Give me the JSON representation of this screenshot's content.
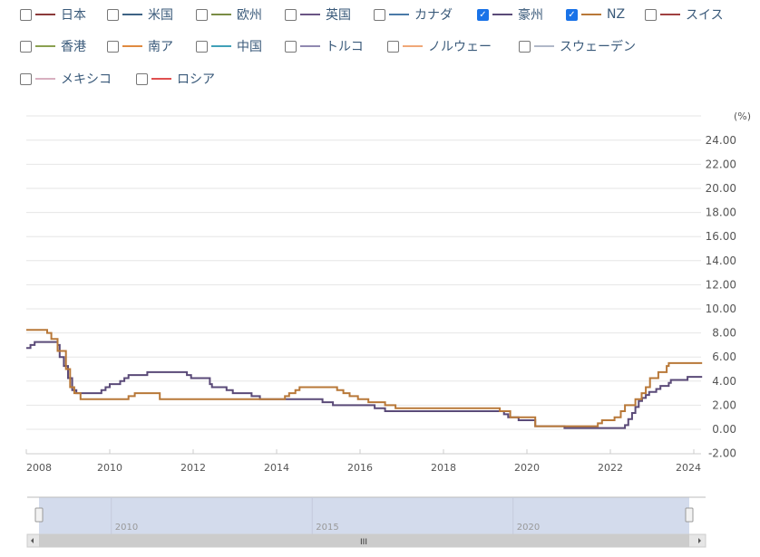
{
  "legend": [
    {
      "label": "日本",
      "color": "#8b3a3a",
      "checked": false
    },
    {
      "label": "米国",
      "color": "#3e6384",
      "checked": false
    },
    {
      "label": "欧州",
      "color": "#7a8c45",
      "checked": false
    },
    {
      "label": "英国",
      "color": "#6a5584",
      "checked": false
    },
    {
      "label": "カナダ",
      "color": "#4a7aa8",
      "checked": false
    },
    {
      "label": "豪州",
      "color": "#5a4a78",
      "checked": true
    },
    {
      "label": "NZ",
      "color": "#b87838",
      "checked": true
    },
    {
      "label": "スイス",
      "color": "#a04040",
      "checked": false
    },
    {
      "label": "香港",
      "color": "#8aa050",
      "checked": false
    },
    {
      "label": "南ア",
      "color": "#e08a40",
      "checked": false
    },
    {
      "label": "中国",
      "color": "#40a0b8",
      "checked": false
    },
    {
      "label": "トルコ",
      "color": "#9088b0",
      "checked": false
    },
    {
      "label": "ノルウェー",
      "color": "#f0a878",
      "checked": false
    },
    {
      "label": "スウェーデン",
      "color": "#b0b8c8",
      "checked": false
    },
    {
      "label": "メキシコ",
      "color": "#d8b0c0",
      "checked": false
    },
    {
      "label": "ロシア",
      "color": "#e05050",
      "checked": false
    }
  ],
  "chart_data": {
    "type": "line",
    "step": true,
    "ylabel": "(%)",
    "ylim": [
      -2,
      26
    ],
    "yticks": [
      "24.00",
      "22.00",
      "20.00",
      "18.00",
      "16.00",
      "14.00",
      "12.00",
      "10.00",
      "8.00",
      "6.00",
      "4.00",
      "2.00",
      "0.00",
      "-2.00"
    ],
    "ytick_values": [
      24,
      22,
      20,
      18,
      16,
      14,
      12,
      10,
      8,
      6,
      4,
      2,
      0,
      -2
    ],
    "xlim": [
      2008,
      2024.2
    ],
    "xticks": [
      "2008",
      "2010",
      "2012",
      "2014",
      "2016",
      "2018",
      "2020",
      "2022",
      "2024"
    ],
    "xtick_values": [
      2008,
      2010,
      2012,
      2014,
      2016,
      2018,
      2020,
      2022,
      2024
    ],
    "series": [
      {
        "name": "豪州",
        "color": "#5a4a78",
        "points": [
          [
            2008,
            6.75
          ],
          [
            2008.1,
            7
          ],
          [
            2008.2,
            7.25
          ],
          [
            2008.75,
            7
          ],
          [
            2008.8,
            6
          ],
          [
            2008.9,
            5.25
          ],
          [
            2009,
            4.25
          ],
          [
            2009.1,
            3.25
          ],
          [
            2009.2,
            3
          ],
          [
            2009.8,
            3.25
          ],
          [
            2009.9,
            3.5
          ],
          [
            2010,
            3.75
          ],
          [
            2010.25,
            4
          ],
          [
            2010.35,
            4.25
          ],
          [
            2010.45,
            4.5
          ],
          [
            2010.9,
            4.75
          ],
          [
            2011.85,
            4.5
          ],
          [
            2011.95,
            4.25
          ],
          [
            2012.4,
            3.75
          ],
          [
            2012.45,
            3.5
          ],
          [
            2012.8,
            3.25
          ],
          [
            2012.95,
            3
          ],
          [
            2013.4,
            2.75
          ],
          [
            2013.6,
            2.5
          ],
          [
            2015.1,
            2.25
          ],
          [
            2015.35,
            2
          ],
          [
            2016.35,
            1.75
          ],
          [
            2016.6,
            1.5
          ],
          [
            2019.45,
            1.25
          ],
          [
            2019.55,
            1
          ],
          [
            2019.8,
            0.75
          ],
          [
            2020.2,
            0.25
          ],
          [
            2020.9,
            0.1
          ],
          [
            2022.35,
            0.35
          ],
          [
            2022.43,
            0.85
          ],
          [
            2022.52,
            1.35
          ],
          [
            2022.6,
            1.85
          ],
          [
            2022.68,
            2.35
          ],
          [
            2022.76,
            2.6
          ],
          [
            2022.85,
            2.85
          ],
          [
            2022.93,
            3.1
          ],
          [
            2023.1,
            3.35
          ],
          [
            2023.2,
            3.6
          ],
          [
            2023.4,
            3.85
          ],
          [
            2023.45,
            4.1
          ],
          [
            2023.85,
            4.35
          ],
          [
            2024.2,
            4.35
          ]
        ]
      },
      {
        "name": "NZ",
        "color": "#b87838",
        "points": [
          [
            2008,
            8.25
          ],
          [
            2008.5,
            8
          ],
          [
            2008.6,
            7.5
          ],
          [
            2008.75,
            6.5
          ],
          [
            2008.95,
            5
          ],
          [
            2009.05,
            3.5
          ],
          [
            2009.15,
            3
          ],
          [
            2009.3,
            2.5
          ],
          [
            2010.45,
            2.75
          ],
          [
            2010.6,
            3
          ],
          [
            2011.2,
            2.5
          ],
          [
            2014.2,
            2.75
          ],
          [
            2014.3,
            3
          ],
          [
            2014.45,
            3.25
          ],
          [
            2014.55,
            3.5
          ],
          [
            2015.45,
            3.25
          ],
          [
            2015.6,
            3
          ],
          [
            2015.75,
            2.75
          ],
          [
            2015.95,
            2.5
          ],
          [
            2016.2,
            2.25
          ],
          [
            2016.6,
            2
          ],
          [
            2016.85,
            1.75
          ],
          [
            2019.35,
            1.5
          ],
          [
            2019.6,
            1
          ],
          [
            2020.2,
            0.25
          ],
          [
            2021.7,
            0.5
          ],
          [
            2021.8,
            0.75
          ],
          [
            2022.1,
            1
          ],
          [
            2022.25,
            1.5
          ],
          [
            2022.35,
            2
          ],
          [
            2022.6,
            2.5
          ],
          [
            2022.75,
            3
          ],
          [
            2022.85,
            3.5
          ],
          [
            2022.95,
            4.25
          ],
          [
            2023.15,
            4.75
          ],
          [
            2023.35,
            5.25
          ],
          [
            2023.4,
            5.5
          ],
          [
            2024.2,
            5.5
          ]
        ]
      }
    ],
    "navigator": {
      "labels": [
        "2010",
        "2015",
        "2020"
      ],
      "values": [
        2010,
        2015,
        2020
      ]
    }
  },
  "scrollbar": {
    "grip": "III"
  }
}
